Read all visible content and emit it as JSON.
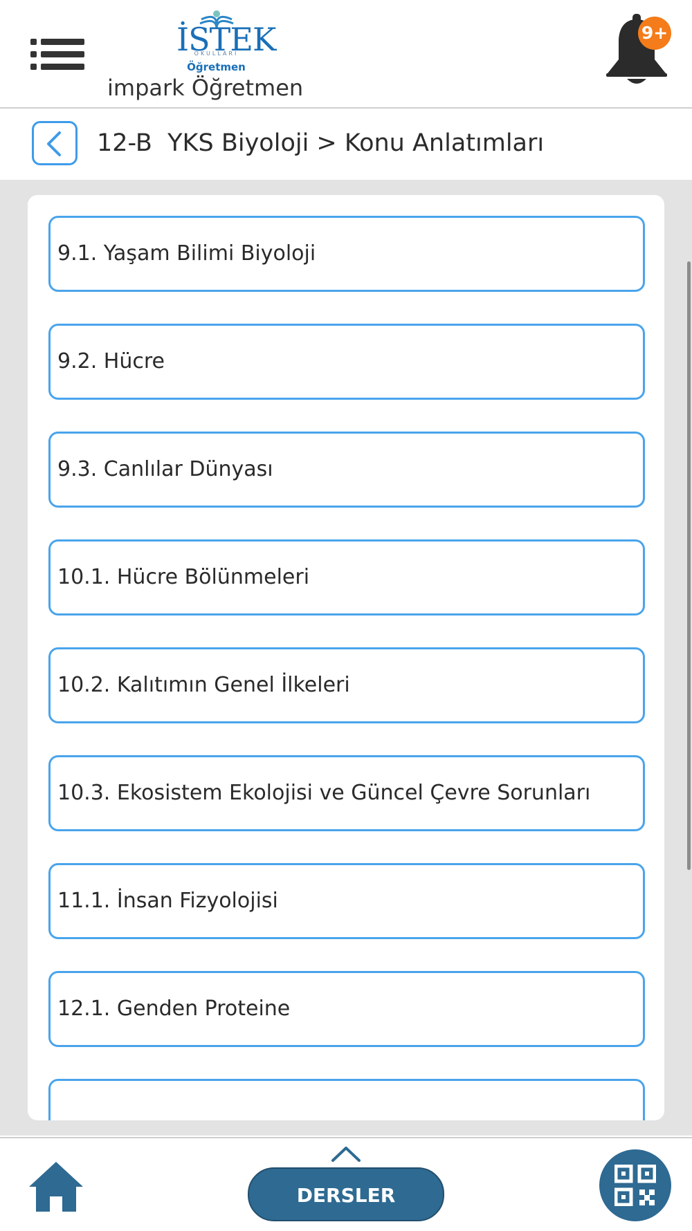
{
  "header": {
    "logo_word": "İSTEK",
    "logo_sub": "OKULLARI",
    "logo_role": "Öğretmen",
    "user_name": "impark Öğretmen",
    "notification_badge": "9+"
  },
  "breadcrumb": {
    "text": "12-B  YKS Biyoloji > Konu Anlatımları"
  },
  "topics": [
    {
      "label": "9.1. Yaşam Bilimi Biyoloji"
    },
    {
      "label": "9.2. Hücre"
    },
    {
      "label": "9.3. Canlılar Dünyası"
    },
    {
      "label": "10.1. Hücre Bölünmeleri"
    },
    {
      "label": "10.2. Kalıtımın Genel İlkeleri"
    },
    {
      "label": "10.3. Ekosistem Ekolojisi ve Güncel Çevre Sorunları"
    },
    {
      "label": "11.1. İnsan Fizyolojisi"
    },
    {
      "label": "12.1. Genden Proteine"
    },
    {
      "label": ""
    }
  ],
  "bottom_bar": {
    "dersler_label": "DERSLER"
  },
  "colors": {
    "accent": "#49a4ec",
    "primary_dark": "#2e6a92",
    "badge": "#f47c1a"
  },
  "icons": [
    "menu-icon",
    "logo",
    "bell-icon",
    "back-arrow-icon",
    "home-icon",
    "chevron-up-icon",
    "qr-code-icon"
  ]
}
